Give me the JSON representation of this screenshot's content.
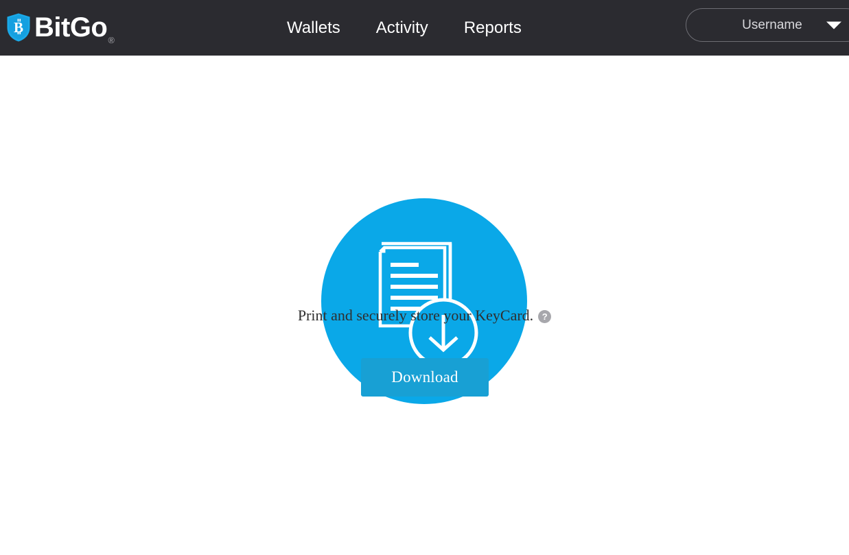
{
  "header": {
    "brand": {
      "name": "BitGo",
      "registered_mark": "®",
      "shield_icon": "bitgo-shield-icon",
      "shield_color": "#1aa9e8",
      "text_color": "#ffffff"
    },
    "background_color": "#2b2b30",
    "nav_items": [
      {
        "label": "Wallets",
        "name": "nav-item-wallets"
      },
      {
        "label": "Activity",
        "name": "nav-item-activity"
      },
      {
        "label": "Reports",
        "name": "nav-item-reports"
      }
    ],
    "user_menu": {
      "label": "Username",
      "caret_icon": "chevron-down-icon"
    }
  },
  "main": {
    "keycard_icon": {
      "name": "keycard-download-icon",
      "circle_color": "#0aa8e8",
      "stroke_color": "#ffffff",
      "document_lines": 5
    },
    "caption": {
      "text": "Print and securely store your KeyCard.",
      "help_icon_glyph": "?",
      "help_icon_color": "#a7a7ac"
    },
    "download_button": {
      "label": "Download",
      "background_color": "#18a0d4",
      "text_color": "#ffffff"
    }
  }
}
